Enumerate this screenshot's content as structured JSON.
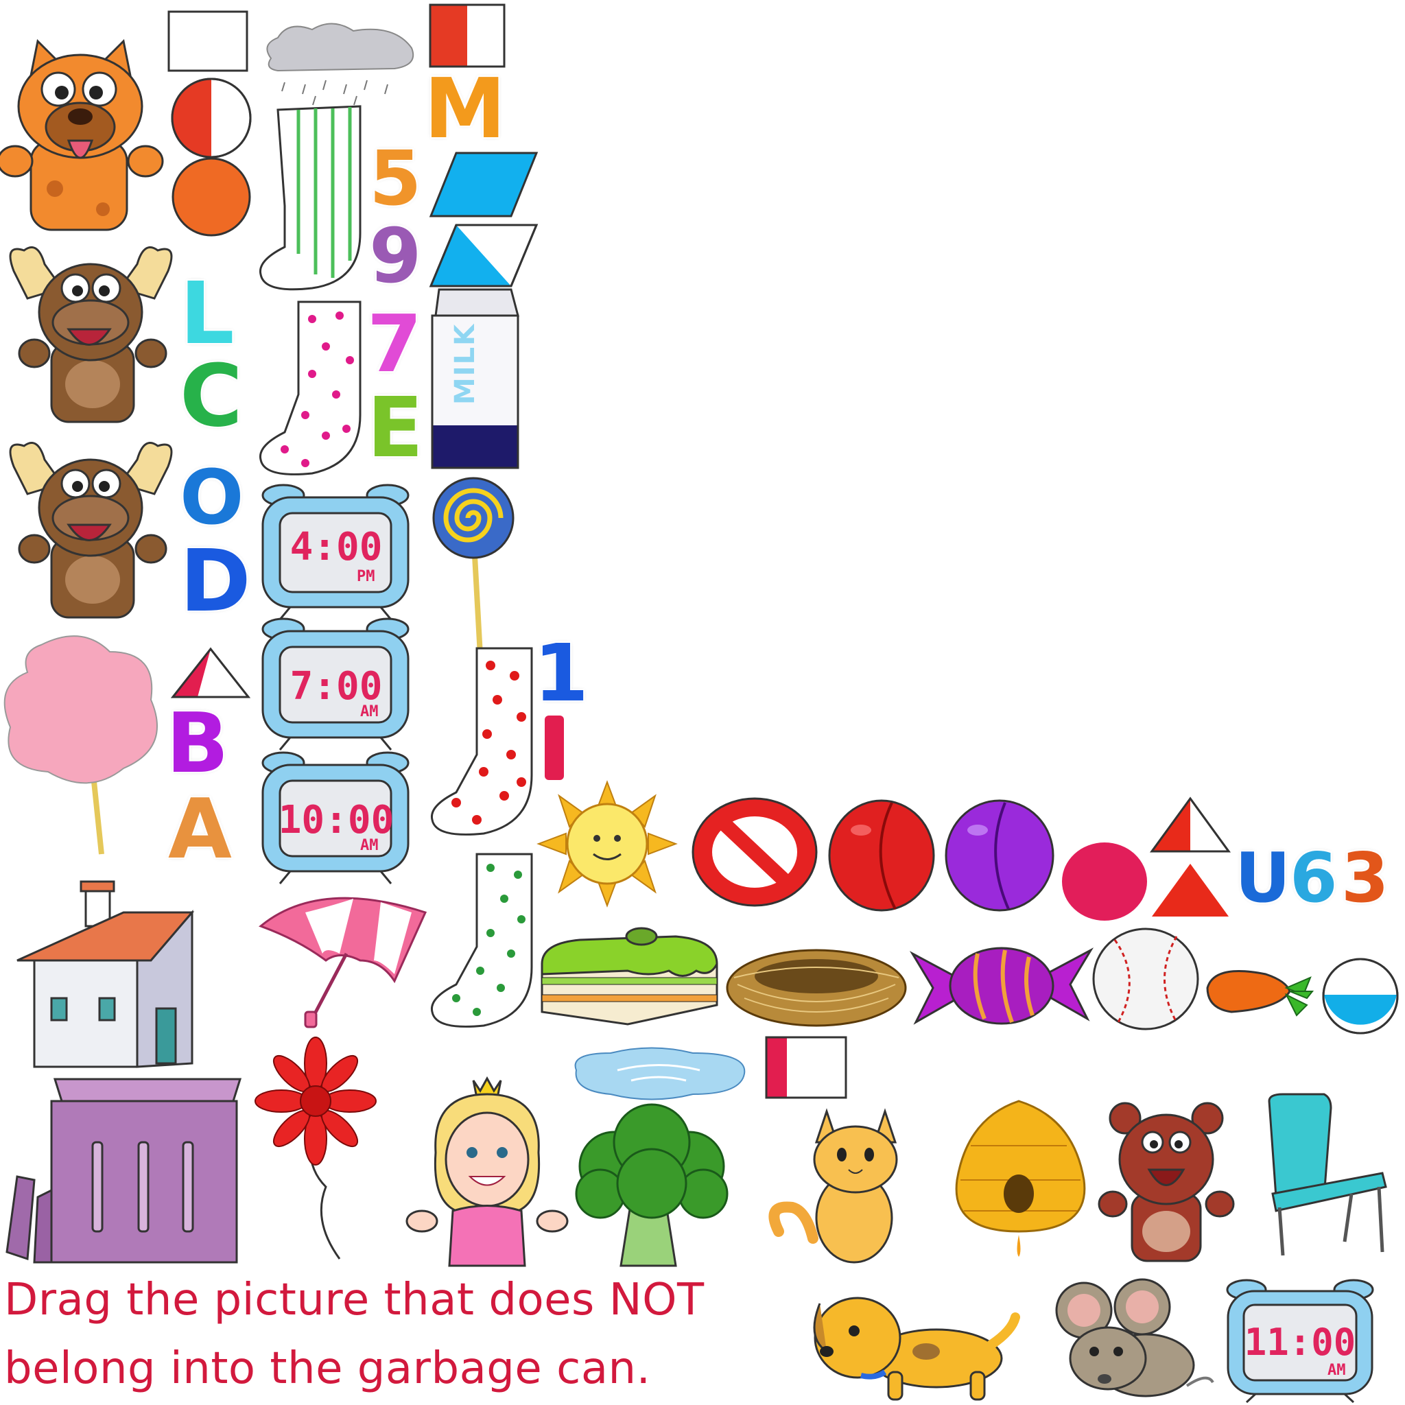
{
  "instruction": {
    "line1": "Drag the picture that does NOT",
    "line2": "belong into the garbage can."
  },
  "letters": {
    "m": "M",
    "l": "L",
    "c": "C",
    "o": "O",
    "d": "D",
    "b": "B",
    "a": "A",
    "e": "E",
    "u": "U"
  },
  "digits": {
    "five": "5",
    "nine": "9",
    "seven": "7",
    "one": "1",
    "six": "6",
    "three": "3"
  },
  "clocks": [
    {
      "time": "4:00",
      "ampm": "PM"
    },
    {
      "time": "7:00",
      "ampm": "AM"
    },
    {
      "time": "10:00",
      "ampm": "AM"
    },
    {
      "time": "11:00",
      "ampm": "AM"
    }
  ],
  "milk_label": "MILK",
  "colors": {
    "instruction": "#d2193d",
    "clock_digits": "#e0245e",
    "clock_body": "#8fd0f0",
    "trash_can": "#b07ab8"
  }
}
